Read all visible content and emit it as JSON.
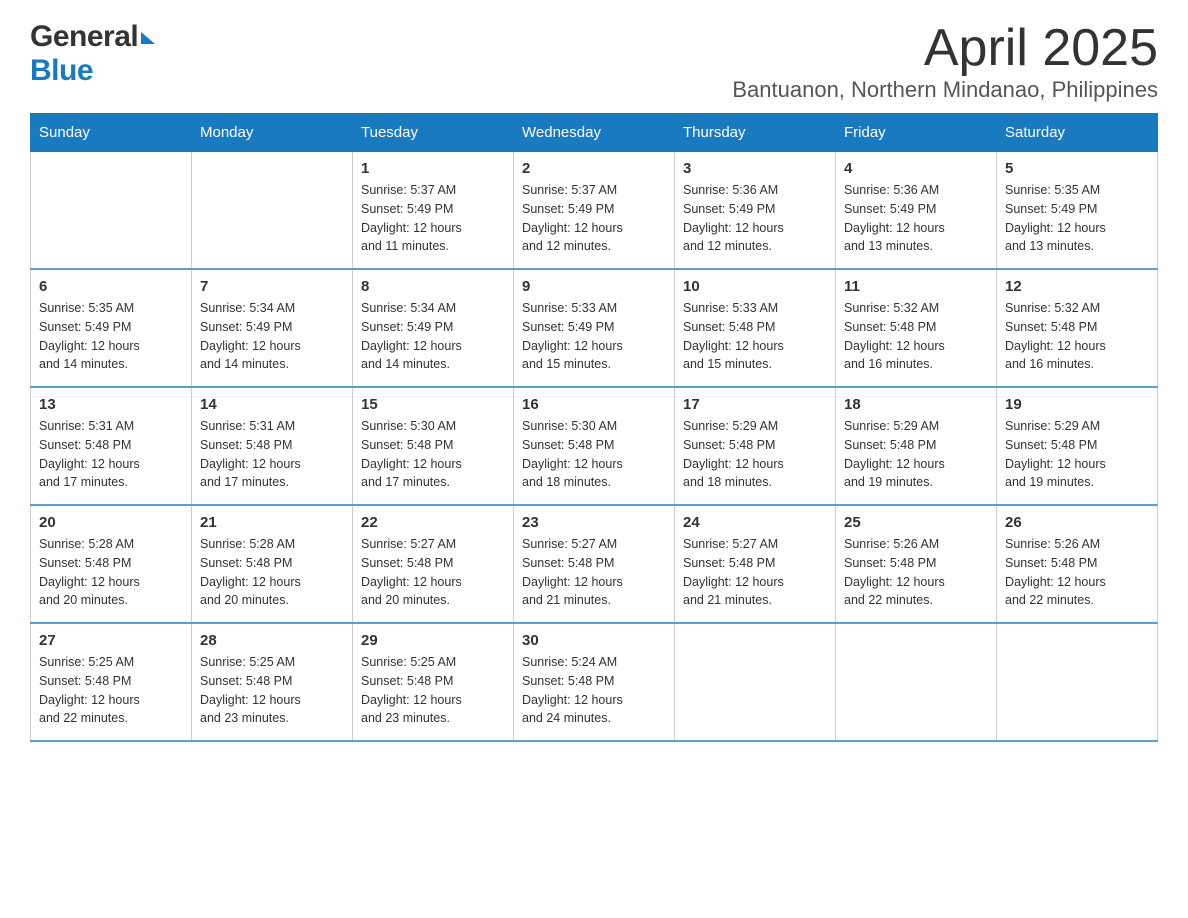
{
  "header": {
    "logo_general": "General",
    "logo_blue": "Blue",
    "month_title": "April 2025",
    "location": "Bantuanon, Northern Mindanao, Philippines"
  },
  "calendar": {
    "days_of_week": [
      "Sunday",
      "Monday",
      "Tuesday",
      "Wednesday",
      "Thursday",
      "Friday",
      "Saturday"
    ],
    "weeks": [
      [
        {
          "day": "",
          "info": ""
        },
        {
          "day": "",
          "info": ""
        },
        {
          "day": "1",
          "info": "Sunrise: 5:37 AM\nSunset: 5:49 PM\nDaylight: 12 hours\nand 11 minutes."
        },
        {
          "day": "2",
          "info": "Sunrise: 5:37 AM\nSunset: 5:49 PM\nDaylight: 12 hours\nand 12 minutes."
        },
        {
          "day": "3",
          "info": "Sunrise: 5:36 AM\nSunset: 5:49 PM\nDaylight: 12 hours\nand 12 minutes."
        },
        {
          "day": "4",
          "info": "Sunrise: 5:36 AM\nSunset: 5:49 PM\nDaylight: 12 hours\nand 13 minutes."
        },
        {
          "day": "5",
          "info": "Sunrise: 5:35 AM\nSunset: 5:49 PM\nDaylight: 12 hours\nand 13 minutes."
        }
      ],
      [
        {
          "day": "6",
          "info": "Sunrise: 5:35 AM\nSunset: 5:49 PM\nDaylight: 12 hours\nand 14 minutes."
        },
        {
          "day": "7",
          "info": "Sunrise: 5:34 AM\nSunset: 5:49 PM\nDaylight: 12 hours\nand 14 minutes."
        },
        {
          "day": "8",
          "info": "Sunrise: 5:34 AM\nSunset: 5:49 PM\nDaylight: 12 hours\nand 14 minutes."
        },
        {
          "day": "9",
          "info": "Sunrise: 5:33 AM\nSunset: 5:49 PM\nDaylight: 12 hours\nand 15 minutes."
        },
        {
          "day": "10",
          "info": "Sunrise: 5:33 AM\nSunset: 5:48 PM\nDaylight: 12 hours\nand 15 minutes."
        },
        {
          "day": "11",
          "info": "Sunrise: 5:32 AM\nSunset: 5:48 PM\nDaylight: 12 hours\nand 16 minutes."
        },
        {
          "day": "12",
          "info": "Sunrise: 5:32 AM\nSunset: 5:48 PM\nDaylight: 12 hours\nand 16 minutes."
        }
      ],
      [
        {
          "day": "13",
          "info": "Sunrise: 5:31 AM\nSunset: 5:48 PM\nDaylight: 12 hours\nand 17 minutes."
        },
        {
          "day": "14",
          "info": "Sunrise: 5:31 AM\nSunset: 5:48 PM\nDaylight: 12 hours\nand 17 minutes."
        },
        {
          "day": "15",
          "info": "Sunrise: 5:30 AM\nSunset: 5:48 PM\nDaylight: 12 hours\nand 17 minutes."
        },
        {
          "day": "16",
          "info": "Sunrise: 5:30 AM\nSunset: 5:48 PM\nDaylight: 12 hours\nand 18 minutes."
        },
        {
          "day": "17",
          "info": "Sunrise: 5:29 AM\nSunset: 5:48 PM\nDaylight: 12 hours\nand 18 minutes."
        },
        {
          "day": "18",
          "info": "Sunrise: 5:29 AM\nSunset: 5:48 PM\nDaylight: 12 hours\nand 19 minutes."
        },
        {
          "day": "19",
          "info": "Sunrise: 5:29 AM\nSunset: 5:48 PM\nDaylight: 12 hours\nand 19 minutes."
        }
      ],
      [
        {
          "day": "20",
          "info": "Sunrise: 5:28 AM\nSunset: 5:48 PM\nDaylight: 12 hours\nand 20 minutes."
        },
        {
          "day": "21",
          "info": "Sunrise: 5:28 AM\nSunset: 5:48 PM\nDaylight: 12 hours\nand 20 minutes."
        },
        {
          "day": "22",
          "info": "Sunrise: 5:27 AM\nSunset: 5:48 PM\nDaylight: 12 hours\nand 20 minutes."
        },
        {
          "day": "23",
          "info": "Sunrise: 5:27 AM\nSunset: 5:48 PM\nDaylight: 12 hours\nand 21 minutes."
        },
        {
          "day": "24",
          "info": "Sunrise: 5:27 AM\nSunset: 5:48 PM\nDaylight: 12 hours\nand 21 minutes."
        },
        {
          "day": "25",
          "info": "Sunrise: 5:26 AM\nSunset: 5:48 PM\nDaylight: 12 hours\nand 22 minutes."
        },
        {
          "day": "26",
          "info": "Sunrise: 5:26 AM\nSunset: 5:48 PM\nDaylight: 12 hours\nand 22 minutes."
        }
      ],
      [
        {
          "day": "27",
          "info": "Sunrise: 5:25 AM\nSunset: 5:48 PM\nDaylight: 12 hours\nand 22 minutes."
        },
        {
          "day": "28",
          "info": "Sunrise: 5:25 AM\nSunset: 5:48 PM\nDaylight: 12 hours\nand 23 minutes."
        },
        {
          "day": "29",
          "info": "Sunrise: 5:25 AM\nSunset: 5:48 PM\nDaylight: 12 hours\nand 23 minutes."
        },
        {
          "day": "30",
          "info": "Sunrise: 5:24 AM\nSunset: 5:48 PM\nDaylight: 12 hours\nand 24 minutes."
        },
        {
          "day": "",
          "info": ""
        },
        {
          "day": "",
          "info": ""
        },
        {
          "day": "",
          "info": ""
        }
      ]
    ]
  }
}
